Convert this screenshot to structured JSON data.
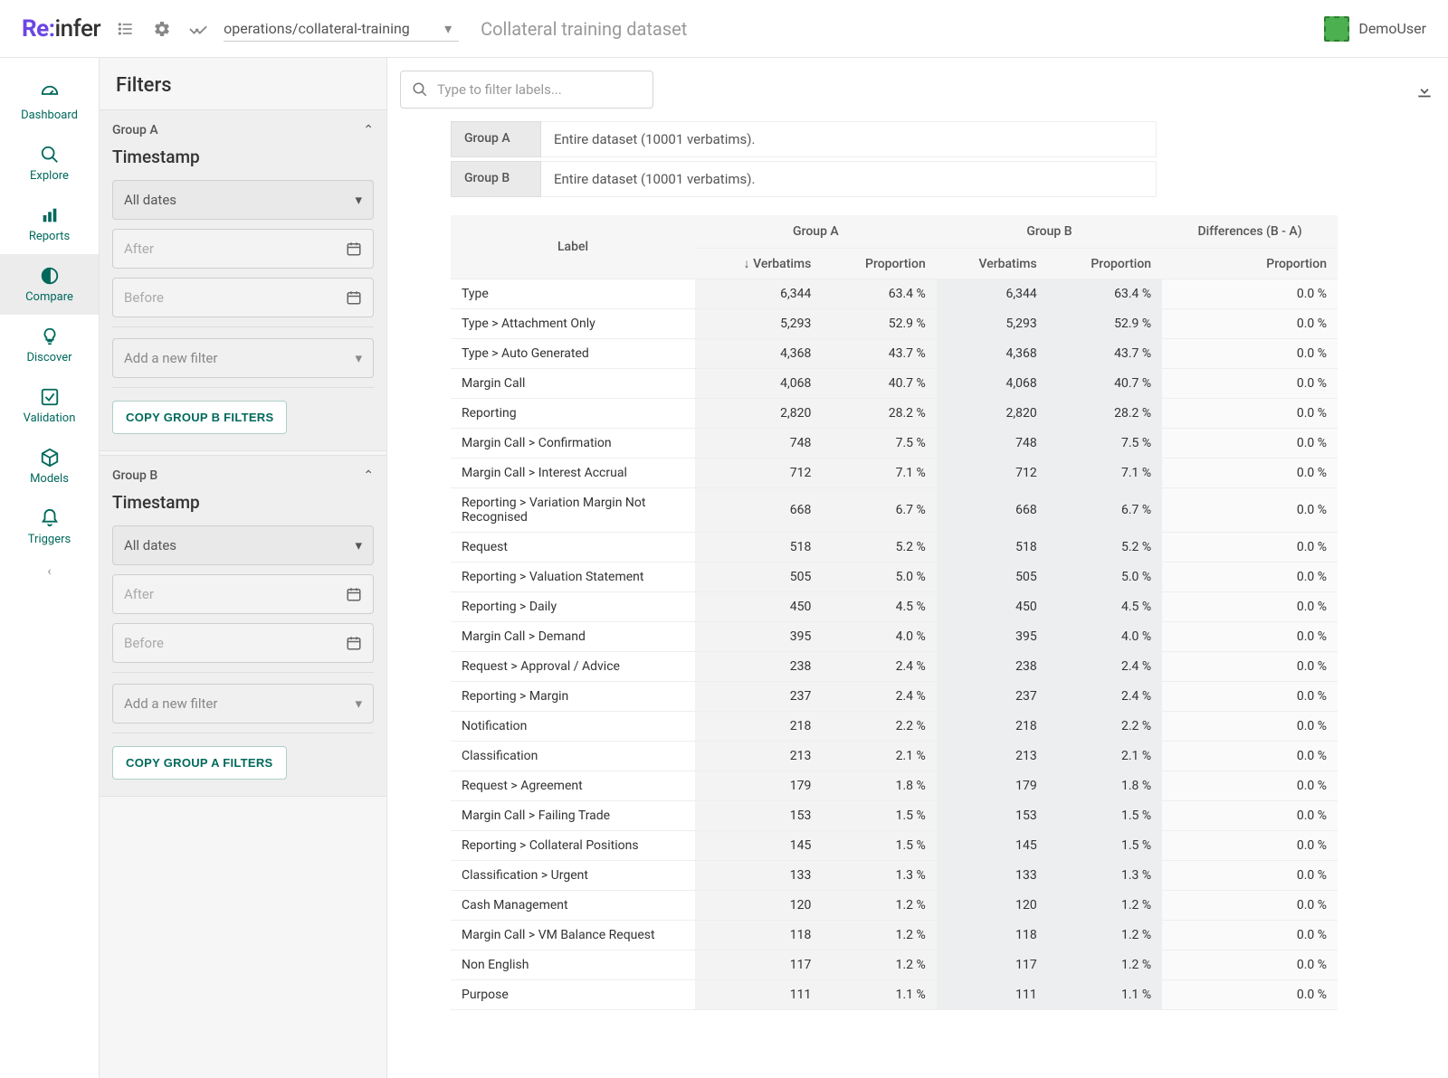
{
  "brand": {
    "re": "Re:",
    "infer": "infer"
  },
  "top": {
    "dataset_path": "operations/collateral-training",
    "dataset_title": "Collateral training dataset",
    "username": "DemoUser"
  },
  "nav": {
    "items": [
      {
        "key": "dashboard",
        "label": "Dashboard"
      },
      {
        "key": "explore",
        "label": "Explore"
      },
      {
        "key": "reports",
        "label": "Reports"
      },
      {
        "key": "compare",
        "label": "Compare"
      },
      {
        "key": "discover",
        "label": "Discover"
      },
      {
        "key": "validation",
        "label": "Validation"
      },
      {
        "key": "models",
        "label": "Models"
      },
      {
        "key": "triggers",
        "label": "Triggers"
      }
    ]
  },
  "filters": {
    "title": "Filters",
    "group_a": {
      "header": "Group A",
      "timestamp_label": "Timestamp",
      "date_select": "All dates",
      "after_placeholder": "After",
      "before_placeholder": "Before",
      "add_filter_placeholder": "Add a new filter",
      "copy_button": "COPY GROUP B FILTERS"
    },
    "group_b": {
      "header": "Group B",
      "timestamp_label": "Timestamp",
      "date_select": "All dates",
      "after_placeholder": "After",
      "before_placeholder": "Before",
      "add_filter_placeholder": "Add a new filter",
      "copy_button": "COPY GROUP A FILTERS"
    }
  },
  "search": {
    "placeholder": "Type to filter labels..."
  },
  "summary": {
    "group_a": {
      "label": "Group A",
      "desc": "Entire dataset (10001 verbatims)."
    },
    "group_b": {
      "label": "Group B",
      "desc": "Entire dataset (10001 verbatims)."
    }
  },
  "table": {
    "headers": {
      "label": "Label",
      "group_a": "Group A",
      "group_b": "Group B",
      "diff": "Differences (B - A)",
      "verbatims": "Verbatims",
      "proportion": "Proportion",
      "sort_indicator": "↓ Verbatims"
    },
    "rows": [
      {
        "label": "Type",
        "a_v": "6,344",
        "a_p": "63.4 %",
        "b_v": "6,344",
        "b_p": "63.4 %",
        "d_p": "0.0 %"
      },
      {
        "label": "Type > Attachment Only",
        "a_v": "5,293",
        "a_p": "52.9 %",
        "b_v": "5,293",
        "b_p": "52.9 %",
        "d_p": "0.0 %"
      },
      {
        "label": "Type > Auto Generated",
        "a_v": "4,368",
        "a_p": "43.7 %",
        "b_v": "4,368",
        "b_p": "43.7 %",
        "d_p": "0.0 %"
      },
      {
        "label": "Margin Call",
        "a_v": "4,068",
        "a_p": "40.7 %",
        "b_v": "4,068",
        "b_p": "40.7 %",
        "d_p": "0.0 %"
      },
      {
        "label": "Reporting",
        "a_v": "2,820",
        "a_p": "28.2 %",
        "b_v": "2,820",
        "b_p": "28.2 %",
        "d_p": "0.0 %"
      },
      {
        "label": "Margin Call > Confirmation",
        "a_v": "748",
        "a_p": "7.5 %",
        "b_v": "748",
        "b_p": "7.5 %",
        "d_p": "0.0 %"
      },
      {
        "label": "Margin Call > Interest Accrual",
        "a_v": "712",
        "a_p": "7.1 %",
        "b_v": "712",
        "b_p": "7.1 %",
        "d_p": "0.0 %"
      },
      {
        "label": "Reporting > Variation Margin Not Recognised",
        "a_v": "668",
        "a_p": "6.7 %",
        "b_v": "668",
        "b_p": "6.7 %",
        "d_p": "0.0 %"
      },
      {
        "label": "Request",
        "a_v": "518",
        "a_p": "5.2 %",
        "b_v": "518",
        "b_p": "5.2 %",
        "d_p": "0.0 %"
      },
      {
        "label": "Reporting > Valuation Statement",
        "a_v": "505",
        "a_p": "5.0 %",
        "b_v": "505",
        "b_p": "5.0 %",
        "d_p": "0.0 %"
      },
      {
        "label": "Reporting > Daily",
        "a_v": "450",
        "a_p": "4.5 %",
        "b_v": "450",
        "b_p": "4.5 %",
        "d_p": "0.0 %"
      },
      {
        "label": "Margin Call > Demand",
        "a_v": "395",
        "a_p": "4.0 %",
        "b_v": "395",
        "b_p": "4.0 %",
        "d_p": "0.0 %"
      },
      {
        "label": "Request > Approval / Advice",
        "a_v": "238",
        "a_p": "2.4 %",
        "b_v": "238",
        "b_p": "2.4 %",
        "d_p": "0.0 %"
      },
      {
        "label": "Reporting > Margin",
        "a_v": "237",
        "a_p": "2.4 %",
        "b_v": "237",
        "b_p": "2.4 %",
        "d_p": "0.0 %"
      },
      {
        "label": "Notification",
        "a_v": "218",
        "a_p": "2.2 %",
        "b_v": "218",
        "b_p": "2.2 %",
        "d_p": "0.0 %"
      },
      {
        "label": "Classification",
        "a_v": "213",
        "a_p": "2.1 %",
        "b_v": "213",
        "b_p": "2.1 %",
        "d_p": "0.0 %"
      },
      {
        "label": "Request > Agreement",
        "a_v": "179",
        "a_p": "1.8 %",
        "b_v": "179",
        "b_p": "1.8 %",
        "d_p": "0.0 %"
      },
      {
        "label": "Margin Call > Failing Trade",
        "a_v": "153",
        "a_p": "1.5 %",
        "b_v": "153",
        "b_p": "1.5 %",
        "d_p": "0.0 %"
      },
      {
        "label": "Reporting > Collateral Positions",
        "a_v": "145",
        "a_p": "1.5 %",
        "b_v": "145",
        "b_p": "1.5 %",
        "d_p": "0.0 %"
      },
      {
        "label": "Classification > Urgent",
        "a_v": "133",
        "a_p": "1.3 %",
        "b_v": "133",
        "b_p": "1.3 %",
        "d_p": "0.0 %"
      },
      {
        "label": "Cash Management",
        "a_v": "120",
        "a_p": "1.2 %",
        "b_v": "120",
        "b_p": "1.2 %",
        "d_p": "0.0 %"
      },
      {
        "label": "Margin Call > VM Balance Request",
        "a_v": "118",
        "a_p": "1.2 %",
        "b_v": "118",
        "b_p": "1.2 %",
        "d_p": "0.0 %"
      },
      {
        "label": "Non English",
        "a_v": "117",
        "a_p": "1.2 %",
        "b_v": "117",
        "b_p": "1.2 %",
        "d_p": "0.0 %"
      },
      {
        "label": "Purpose",
        "a_v": "111",
        "a_p": "1.1 %",
        "b_v": "111",
        "b_p": "1.1 %",
        "d_p": "0.0 %"
      }
    ]
  }
}
